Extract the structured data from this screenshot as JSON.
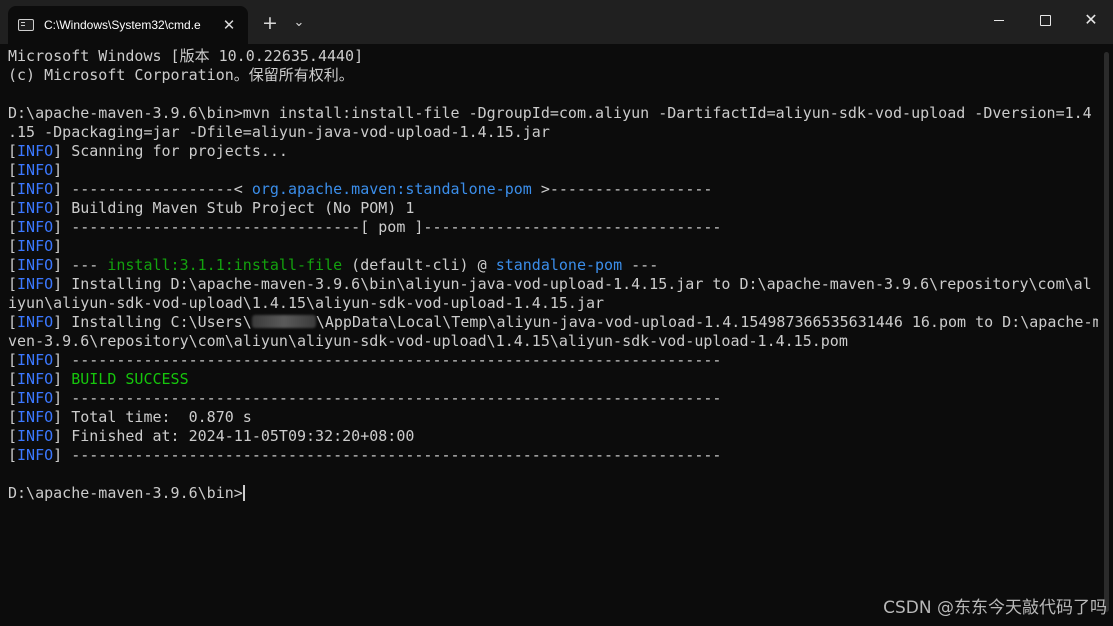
{
  "tab": {
    "title": "C:\\Windows\\System32\\cmd.e",
    "icon": "cmd-icon",
    "close_glyph": "✕"
  },
  "toolbar": {
    "new_tab_glyph": "+",
    "menu_glyph": "⌄"
  },
  "window_controls": {
    "close_glyph": "✕"
  },
  "console": {
    "lines": [
      {
        "segs": [
          {
            "t": "Microsoft Windows [版本 10.0.22635.4440]"
          }
        ]
      },
      {
        "segs": [
          {
            "t": "(c) Microsoft Corporation。保留所有权利。"
          }
        ]
      },
      {
        "segs": [
          {
            "t": ""
          }
        ]
      },
      {
        "segs": [
          {
            "t": "D:\\apache-maven-3.9.6\\bin>mvn install:install-file -DgroupId=com.aliyun -DartifactId=aliyun-sdk-vod-upload -Dversion=1.4"
          }
        ]
      },
      {
        "segs": [
          {
            "t": ".15 -Dpackaging=jar -Dfile=aliyun-java-vod-upload-1.4.15.jar"
          }
        ]
      },
      {
        "segs": [
          {
            "t": "[",
            "c": "bracket"
          },
          {
            "t": "INFO",
            "c": "info"
          },
          {
            "t": "] Scanning for projects..."
          }
        ]
      },
      {
        "segs": [
          {
            "t": "[",
            "c": "bracket"
          },
          {
            "t": "INFO",
            "c": "info"
          },
          {
            "t": "]"
          }
        ]
      },
      {
        "segs": [
          {
            "t": "[",
            "c": "bracket"
          },
          {
            "t": "INFO",
            "c": "info"
          },
          {
            "t": "] ------------------< "
          },
          {
            "t": "org.apache.maven:standalone-pom",
            "c": "link"
          },
          {
            "t": " >------------------"
          }
        ]
      },
      {
        "segs": [
          {
            "t": "[",
            "c": "bracket"
          },
          {
            "t": "INFO",
            "c": "info"
          },
          {
            "t": "] Building Maven Stub Project (No POM) 1"
          }
        ]
      },
      {
        "segs": [
          {
            "t": "[",
            "c": "bracket"
          },
          {
            "t": "INFO",
            "c": "info"
          },
          {
            "t": "] --------------------------------[ pom ]---------------------------------"
          }
        ]
      },
      {
        "segs": [
          {
            "t": "[",
            "c": "bracket"
          },
          {
            "t": "INFO",
            "c": "info"
          },
          {
            "t": "]"
          }
        ]
      },
      {
        "segs": [
          {
            "t": "[",
            "c": "bracket"
          },
          {
            "t": "INFO",
            "c": "info"
          },
          {
            "t": "] --- "
          },
          {
            "t": "install:3.1.1:install-file",
            "c": "green"
          },
          {
            "t": " (default-cli) @ "
          },
          {
            "t": "standalone-pom",
            "c": "link"
          },
          {
            "t": " ---"
          }
        ]
      },
      {
        "segs": [
          {
            "t": "[",
            "c": "bracket"
          },
          {
            "t": "INFO",
            "c": "info"
          },
          {
            "t": "] Installing D:\\apache-maven-3.9.6\\bin\\aliyun-java-vod-upload-1.4.15.jar to D:\\apache-maven-3.9.6\\repository\\com\\al"
          }
        ]
      },
      {
        "segs": [
          {
            "t": "iyun\\aliyun-sdk-vod-upload\\1.4.15\\aliyun-sdk-vod-upload-1.4.15.jar"
          }
        ]
      },
      {
        "segs": [
          {
            "t": "[",
            "c": "bracket"
          },
          {
            "t": "INFO",
            "c": "info"
          },
          {
            "t": "] Installing C:\\Users\\"
          },
          {
            "t": "",
            "c": "redacted"
          },
          {
            "t": "\\AppData\\Local\\Temp\\aliyun-java-vod-upload-1.4.154987366535631446 16.pom to D:\\apache-ma"
          }
        ]
      },
      {
        "segs": [
          {
            "t": "ven-3.9.6\\repository\\com\\aliyun\\aliyun-sdk-vod-upload\\1.4.15\\aliyun-sdk-vod-upload-1.4.15.pom"
          }
        ]
      },
      {
        "segs": [
          {
            "t": "[",
            "c": "bracket"
          },
          {
            "t": "INFO",
            "c": "info"
          },
          {
            "t": "] ------------------------------------------------------------------------"
          }
        ]
      },
      {
        "segs": [
          {
            "t": "[",
            "c": "bracket"
          },
          {
            "t": "INFO",
            "c": "info"
          },
          {
            "t": "] "
          },
          {
            "t": "BUILD SUCCESS",
            "c": "success"
          }
        ]
      },
      {
        "segs": [
          {
            "t": "[",
            "c": "bracket"
          },
          {
            "t": "INFO",
            "c": "info"
          },
          {
            "t": "] ------------------------------------------------------------------------"
          }
        ]
      },
      {
        "segs": [
          {
            "t": "[",
            "c": "bracket"
          },
          {
            "t": "INFO",
            "c": "info"
          },
          {
            "t": "] Total time:  0.870 s"
          }
        ]
      },
      {
        "segs": [
          {
            "t": "[",
            "c": "bracket"
          },
          {
            "t": "INFO",
            "c": "info"
          },
          {
            "t": "] Finished at: 2024-11-05T09:32:20+08:00"
          }
        ]
      },
      {
        "segs": [
          {
            "t": "[",
            "c": "bracket"
          },
          {
            "t": "INFO",
            "c": "info"
          },
          {
            "t": "] ------------------------------------------------------------------------"
          }
        ]
      },
      {
        "segs": [
          {
            "t": ""
          }
        ]
      },
      {
        "segs": [
          {
            "t": "D:\\apache-maven-3.9.6\\bin>"
          },
          {
            "t": "",
            "c": "cursor"
          }
        ]
      }
    ]
  },
  "watermark": "CSDN @东东今天敲代码了吗",
  "colors": {
    "background": "#0c0c0c",
    "titlebar": "#202020",
    "text": "#cccccc",
    "info": "#3b78ff",
    "link": "#3b8eea",
    "green": "#13a10e",
    "success": "#16c60c"
  }
}
